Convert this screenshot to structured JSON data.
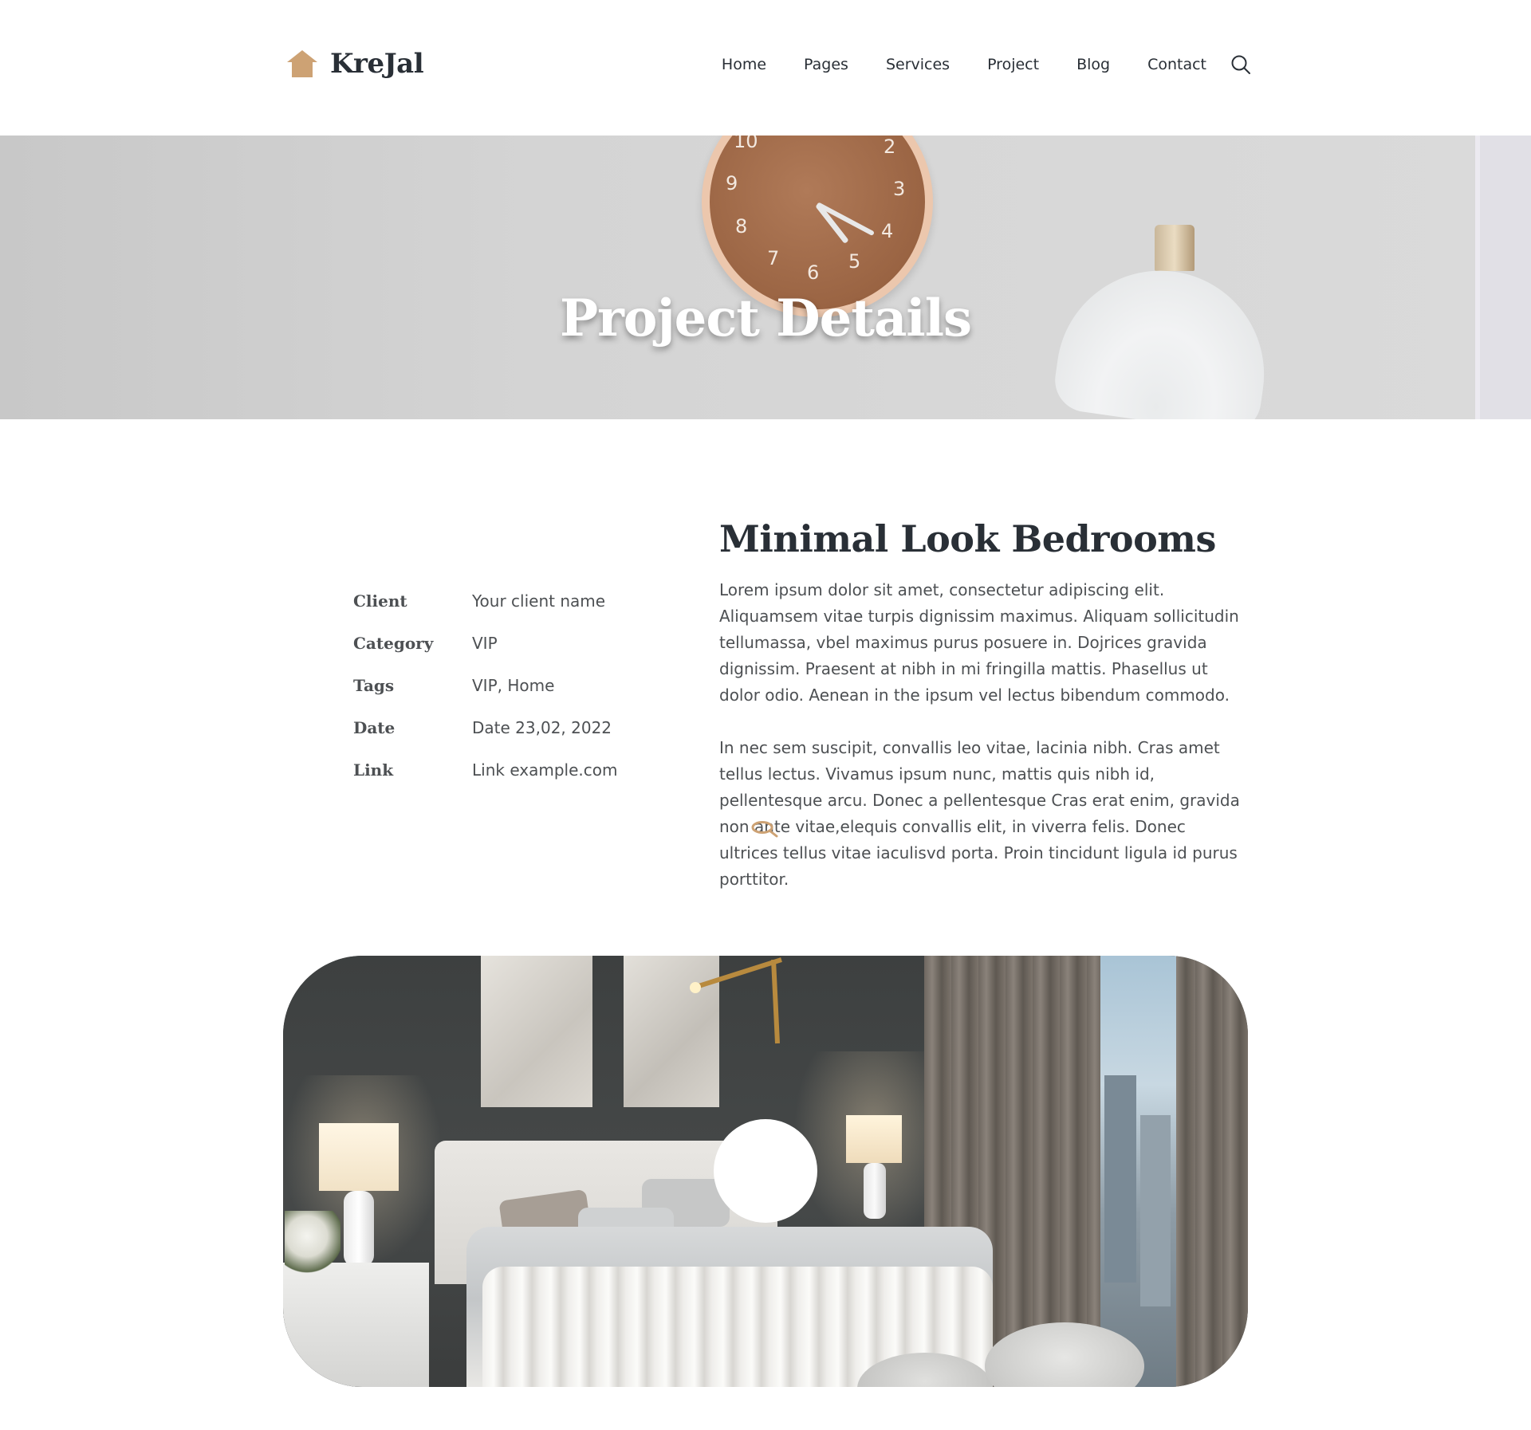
{
  "header": {
    "logo_text": "KreJal",
    "logo_icon": "house-icon",
    "nav": [
      {
        "label": "Home"
      },
      {
        "label": "Pages"
      },
      {
        "label": "Services"
      },
      {
        "label": "Project"
      },
      {
        "label": "Blog"
      },
      {
        "label": "Contact"
      }
    ],
    "search_icon": "search-icon"
  },
  "banner": {
    "title": "Project Details"
  },
  "details": [
    {
      "label": "Client",
      "value": "Your client name"
    },
    {
      "label": "Category",
      "value": "VIP"
    },
    {
      "label": "Tags",
      "value": "VIP, Home"
    },
    {
      "label": "Date",
      "value": "Date 23,02, 2022"
    },
    {
      "label": "Link",
      "value": "Link example.com"
    }
  ],
  "article": {
    "title": "Minimal Look Bedrooms",
    "paragraphs": [
      "Lorem ipsum dolor sit amet, consectetur adipiscing elit. Aliquamsem vitae turpis dignissim maximus. Aliquam sollicitudin tellumassa, vbel maximus purus posuere in. Dojrices gravida dignissim. Praesent at nibh in mi fringilla mattis. Phasellus ut dolor odio. Aenean in the ipsum vel lectus bibendum commodo.",
      "In nec sem suscipit, convallis leo vitae, lacinia nibh. Cras amet tellus lectus. Vivamus ipsum nunc, mattis quis nibh id, pellentesque arcu. Donec a pellentesque Cras erat enim, gravida non ante vitae,elequis convallis elit, in viverra felis. Donec ultrices tellus vitae iaculisvd porta. Proin tincidunt ligula id purus porttitor."
    ]
  },
  "colors": {
    "brand_accent": "#CDA274",
    "heading": "#292F36",
    "body_text": "#4D5053"
  },
  "media": {
    "image": "bedroom-photo",
    "play_button_icon": "play-button"
  }
}
